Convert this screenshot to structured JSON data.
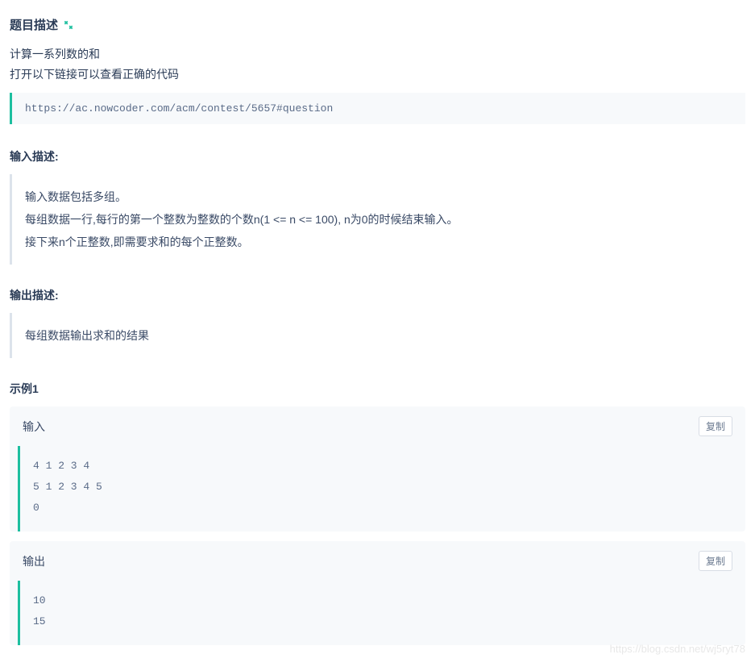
{
  "title": "题目描述",
  "description": {
    "line1": "计算一系列数的和",
    "line2": "打开以下链接可以查看正确的代码"
  },
  "codeLink": "https://ac.nowcoder.com/acm/contest/5657#question",
  "inputDesc": {
    "title": "输入描述:",
    "line1": "输入数据包括多组。",
    "line2": "每组数据一行,每行的第一个整数为整数的个数n(1 <= n <= 100), n为0的时候结束输入。",
    "line3": "接下来n个正整数,即需要求和的每个正整数。"
  },
  "outputDesc": {
    "title": "输出描述:",
    "content": "每组数据输出求和的结果"
  },
  "example": {
    "title": "示例1",
    "input": {
      "label": "输入",
      "content": "4 1 2 3 4\n5 1 2 3 4 5\n0"
    },
    "output": {
      "label": "输出",
      "content": "10\n15"
    },
    "copyBtn": "复制"
  },
  "watermark": "https://blog.csdn.net/wj5ryt78"
}
